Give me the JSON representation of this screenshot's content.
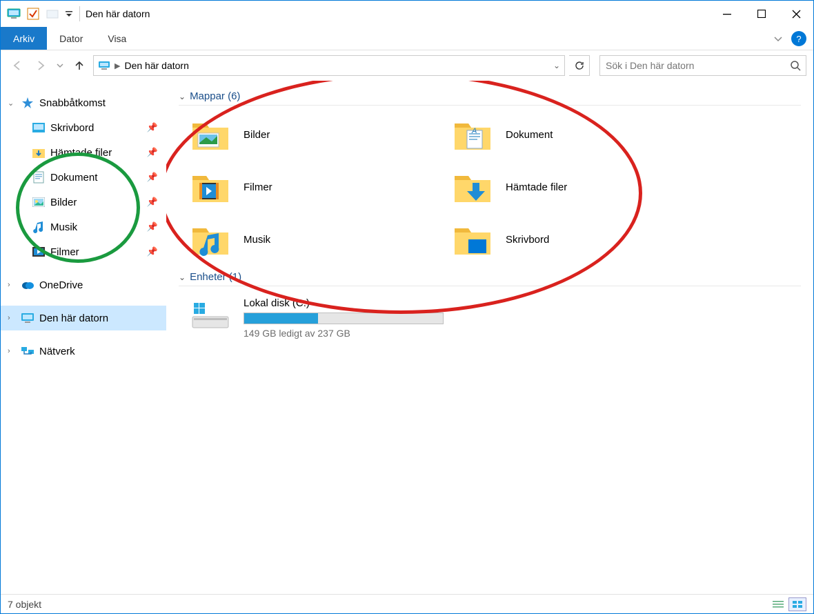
{
  "window": {
    "title": "Den här datorn"
  },
  "ribbon": {
    "tabs": [
      {
        "label": "Arkiv",
        "active": true
      },
      {
        "label": "Dator",
        "active": false
      },
      {
        "label": "Visa",
        "active": false
      }
    ],
    "help": "?"
  },
  "nav": {
    "breadcrumb": "Den här datorn",
    "search_placeholder": "Sök i Den här datorn"
  },
  "sidebar": {
    "quick_access": "Snabbåtkomst",
    "items": [
      {
        "label": "Skrivbord"
      },
      {
        "label": "Hämtade filer"
      },
      {
        "label": "Dokument"
      },
      {
        "label": "Bilder"
      },
      {
        "label": "Musik"
      },
      {
        "label": "Filmer"
      }
    ],
    "onedrive": "OneDrive",
    "this_pc": "Den här datorn",
    "network": "Nätverk"
  },
  "content": {
    "folders_header": "Mappar (6)",
    "folders": [
      {
        "label": "Bilder"
      },
      {
        "label": "Dokument"
      },
      {
        "label": "Filmer"
      },
      {
        "label": "Hämtade filer"
      },
      {
        "label": "Musik"
      },
      {
        "label": "Skrivbord"
      }
    ],
    "drives_header": "Enheter (1)",
    "drive": {
      "name": "Lokal disk (C:)",
      "free_text": "149 GB ledigt av 237 GB",
      "fill_percent": 37
    }
  },
  "status": {
    "text": "7 objekt"
  }
}
